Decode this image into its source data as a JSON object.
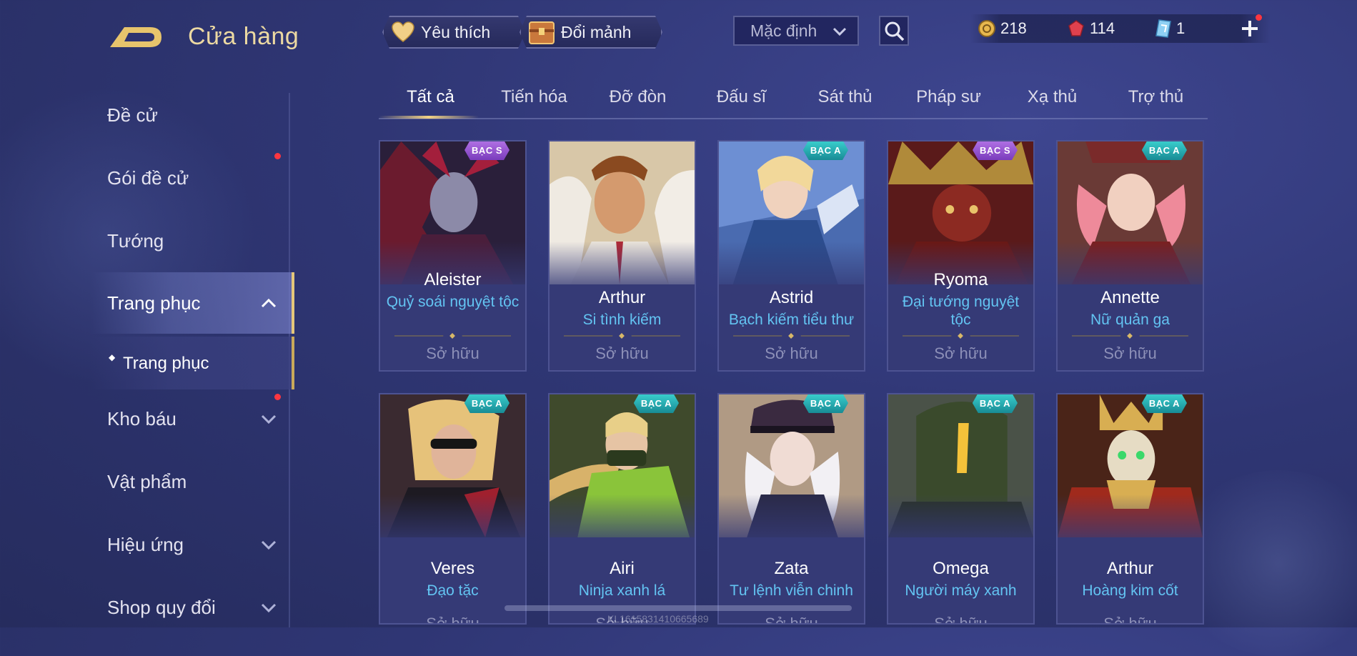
{
  "header": {
    "title": "Cửa hàng",
    "favorite_label": "Yêu thích",
    "exchange_label": "Đổi mảnh",
    "sort": {
      "selected": "Mặc định"
    },
    "currencies": [
      {
        "icon": "gold-coin-icon",
        "value": "218"
      },
      {
        "icon": "red-gem-icon",
        "value": "114"
      },
      {
        "icon": "ticket-icon",
        "value": "1"
      }
    ]
  },
  "sidebar": {
    "items": [
      {
        "label": "Đề cử"
      },
      {
        "label": "Gói đề cử"
      },
      {
        "label": "Tướng"
      },
      {
        "label": "Trang phục"
      },
      {
        "label": "Trang phục"
      },
      {
        "label": "Kho báu"
      },
      {
        "label": "Vật phẩm"
      },
      {
        "label": "Hiệu ứng"
      },
      {
        "label": "Shop quy đổi"
      }
    ]
  },
  "tabs": [
    {
      "label": "Tất cả"
    },
    {
      "label": "Tiến hóa"
    },
    {
      "label": "Đỡ đòn"
    },
    {
      "label": "Đấu sĩ"
    },
    {
      "label": "Sát thủ"
    },
    {
      "label": "Pháp sư"
    },
    {
      "label": "Xạ thủ"
    },
    {
      "label": "Trợ thủ"
    }
  ],
  "cards": [
    {
      "hero": "Aleister",
      "skin": "Quỷ soái nguyệt tộc",
      "badge": "BẠC S",
      "status": "Sở hữu"
    },
    {
      "hero": "Arthur",
      "skin": "Si tình kiếm",
      "badge": "",
      "status": "Sở hữu"
    },
    {
      "hero": "Astrid",
      "skin": "Bạch kiếm tiểu thư",
      "badge": "BẠC A",
      "status": "Sở hữu"
    },
    {
      "hero": "Ryoma",
      "skin": "Đại tướng nguyệt tộc",
      "badge": "BẠC S",
      "status": "Sở hữu"
    },
    {
      "hero": "Annette",
      "skin": "Nữ quản ga",
      "badge": "BẠC A",
      "status": "Sở hữu"
    },
    {
      "hero": "Veres",
      "skin": "Đạo tặc",
      "badge": "BẠC A",
      "status": "Sở hữu"
    },
    {
      "hero": "Airi",
      "skin": "Ninja xanh lá",
      "badge": "BẠC A",
      "status": "Sở hữu"
    },
    {
      "hero": "Zata",
      "skin": "Tư lệnh viễn chinh",
      "badge": "BẠC A",
      "status": "Sở hữu"
    },
    {
      "hero": "Omega",
      "skin": "Người máy xanh",
      "badge": "BẠC A",
      "status": "Sở hữu"
    },
    {
      "hero": "Arthur",
      "skin": "Hoàng kim cốt",
      "badge": "BẠC A",
      "status": "Sở hữu"
    }
  ],
  "watermark": "KL1615831410665689",
  "colors": {
    "accent_gold": "#ecd9a2",
    "skin_name": "#63c4f2",
    "badge_s": "#9a55d4",
    "badge_a": "#26b0b4",
    "notify_dot": "#ff3640"
  }
}
